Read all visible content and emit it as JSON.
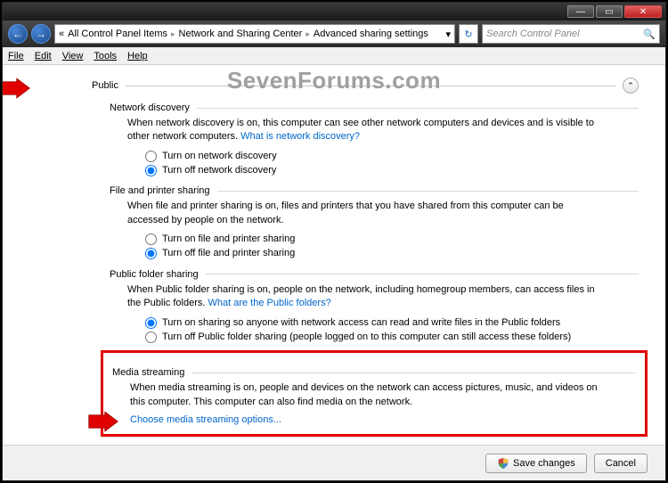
{
  "titlebar": {
    "min": "—",
    "max": "▭",
    "close": "✕"
  },
  "nav": {
    "back": "←",
    "fwd": "→",
    "sep": "▸",
    "chev": "«",
    "refresh": "↻"
  },
  "breadcrumbs": [
    "All Control Panel Items",
    "Network and Sharing Center",
    "Advanced sharing settings"
  ],
  "search": {
    "placeholder": "Search Control Panel"
  },
  "menu": {
    "file": "File",
    "edit": "Edit",
    "view": "View",
    "tools": "Tools",
    "help": "Help"
  },
  "watermark": "SevenForums.com",
  "profile": {
    "label": "Public",
    "collapse": "⌃"
  },
  "sections": {
    "netdisc": {
      "title": "Network discovery",
      "desc": "When network discovery is on, this computer can see other network computers and devices and is visible to other network computers. ",
      "link": "What is network discovery?",
      "on": "Turn on network discovery",
      "off": "Turn off network discovery"
    },
    "fileprint": {
      "title": "File and printer sharing",
      "desc": "When file and printer sharing is on, files and printers that you have shared from this computer can be accessed by people on the network.",
      "on": "Turn on file and printer sharing",
      "off": "Turn off file and printer sharing"
    },
    "pubfolder": {
      "title": "Public folder sharing",
      "desc": "When Public folder sharing is on, people on the network, including homegroup members, can access files in the Public folders. ",
      "link": "What are the Public folders?",
      "on": "Turn on sharing so anyone with network access can read and write files in the Public folders",
      "off": "Turn off Public folder sharing (people logged on to this computer can still access these folders)"
    },
    "media": {
      "title": "Media streaming",
      "desc": "When media streaming is on, people and devices on the network can access pictures, music, and videos on this computer. This computer can also find media on the network.",
      "link": "Choose media streaming options..."
    }
  },
  "footer": {
    "save": "Save changes",
    "cancel": "Cancel"
  }
}
